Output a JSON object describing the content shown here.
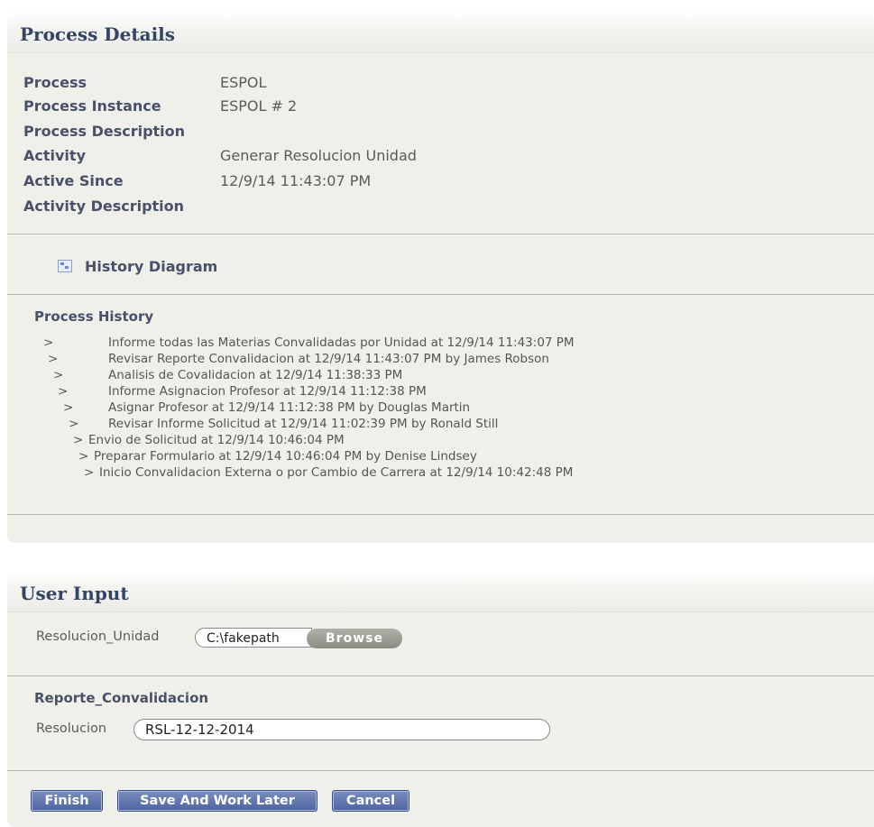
{
  "process_details": {
    "title": "Process Details",
    "fields": [
      {
        "label": "Process",
        "value": "ESPOL"
      },
      {
        "label": "Process Instance",
        "value": "ESPOL # 2"
      },
      {
        "label": "Process Description",
        "value": ""
      },
      {
        "label": "Activity",
        "value": "Generar Resolucion Unidad"
      },
      {
        "label": "Active Since",
        "value": "12/9/14 11:43:07 PM"
      },
      {
        "label": "Activity Description",
        "value": ""
      }
    ],
    "history_diagram_label": "History Diagram",
    "history_diagram_icon": "diagram-icon",
    "process_history": {
      "title": "Process History",
      "arrow": ">",
      "entries": [
        "Informe todas las Materias Convalidadas por Unidad at 12/9/14 11:43:07 PM",
        "Revisar Reporte Convalidacion at 12/9/14 11:43:07 PM by James Robson",
        "Analisis de Covalidacion at 12/9/14 11:38:33 PM",
        "Informe Asignacion Profesor at 12/9/14 11:12:38 PM",
        "Asignar Profesor at 12/9/14 11:12:38 PM by Douglas Martin",
        "Revisar Informe Solicitud at 12/9/14 11:02:39 PM by Ronald Still",
        "Envio de Solicitud at 12/9/14 10:46:04 PM",
        "Preparar Formulario at 12/9/14 10:46:04 PM by Denise Lindsey",
        "Inicio Convalidacion Externa o por Cambio de Carrera at 12/9/14 10:42:48 PM"
      ]
    }
  },
  "user_input": {
    "title": "User Input",
    "file_field": {
      "label": "Resolucion_Unidad",
      "value": "C:\\fakepath",
      "browse_label": "Browse"
    },
    "section_title": "Reporte_Convalidacion",
    "text_field": {
      "label": "Resolucion",
      "value": "RSL-12-12-2014"
    },
    "buttons": {
      "finish": "Finish",
      "save_later": "Save And Work Later",
      "cancel": "Cancel"
    }
  },
  "colors": {
    "button_blue": "#5a6fa8",
    "label_navy": "#48506a",
    "panel_bg": "#f0f0eb"
  }
}
